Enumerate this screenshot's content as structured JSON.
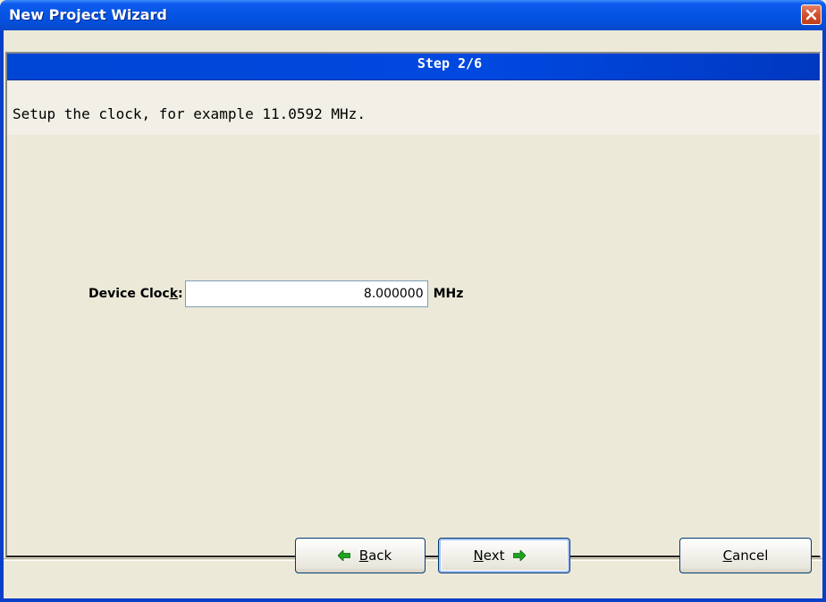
{
  "window": {
    "title": "New Project Wizard"
  },
  "step": {
    "label": "Step 2/6"
  },
  "description": "Setup the clock, for example 11.0592 MHz.",
  "form": {
    "clock_label_pre": "Device Cloc",
    "clock_label_accel": "k",
    "clock_label_post": ":",
    "clock_value": "8.000000",
    "unit": "MHz"
  },
  "buttons": {
    "back_accel": "B",
    "back_rest": "ack",
    "next_accel": "N",
    "next_rest": "ext",
    "cancel_accel": "C",
    "cancel_rest": "ancel"
  },
  "icons": {
    "close": "close-icon",
    "back_arrow": "arrow-left-icon",
    "next_arrow": "arrow-right-icon"
  },
  "colors": {
    "titlebar": "#0554e3",
    "step_bar": "#0046d5",
    "close_button": "#d0502c",
    "arrow_green": "#1fa31f"
  }
}
